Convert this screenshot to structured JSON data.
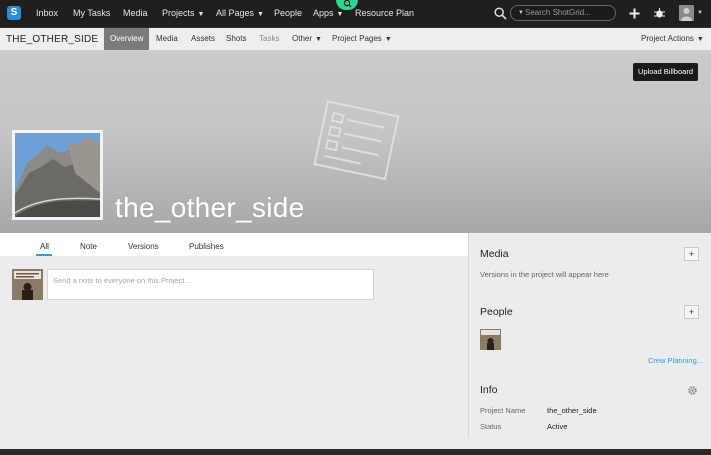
{
  "topnav": {
    "logo": "S",
    "items": [
      {
        "label": "Inbox"
      },
      {
        "label": "My Tasks"
      },
      {
        "label": "Media"
      },
      {
        "label": "Projects"
      },
      {
        "label": "All Pages"
      },
      {
        "label": "People"
      },
      {
        "label": "Apps"
      },
      {
        "label": "Resource Plan"
      }
    ],
    "search_placeholder": "Search ShotGrid..."
  },
  "subnav": {
    "project_name": "THE_OTHER_SIDE",
    "tabs": [
      {
        "label": "Overview"
      },
      {
        "label": "Media"
      },
      {
        "label": "Assets"
      },
      {
        "label": "Shots"
      },
      {
        "label": "Tasks"
      },
      {
        "label": "Other"
      },
      {
        "label": "Project Pages"
      }
    ],
    "actions_label": "Project Actions"
  },
  "hero": {
    "upload_label": "Upload Billboard",
    "title": "the_other_side"
  },
  "activity": {
    "tabs": [
      {
        "label": "All"
      },
      {
        "label": "Note"
      },
      {
        "label": "Versions"
      },
      {
        "label": "Publishes"
      }
    ],
    "note_placeholder": "Send a note to everyone on this Project..."
  },
  "sidebar": {
    "media_title": "Media",
    "media_empty": "Versions in the project will appear here",
    "people_title": "People",
    "crew_link": "Crew Planning...",
    "info_title": "Info",
    "info_rows": [
      {
        "key": "Project Name",
        "value": "the_other_side"
      },
      {
        "key": "Status",
        "value": "Active"
      }
    ]
  },
  "colors": {
    "accent": "#2f9cd6",
    "apps_badge": "#2fd68b",
    "topbar": "#1f1f1f"
  }
}
